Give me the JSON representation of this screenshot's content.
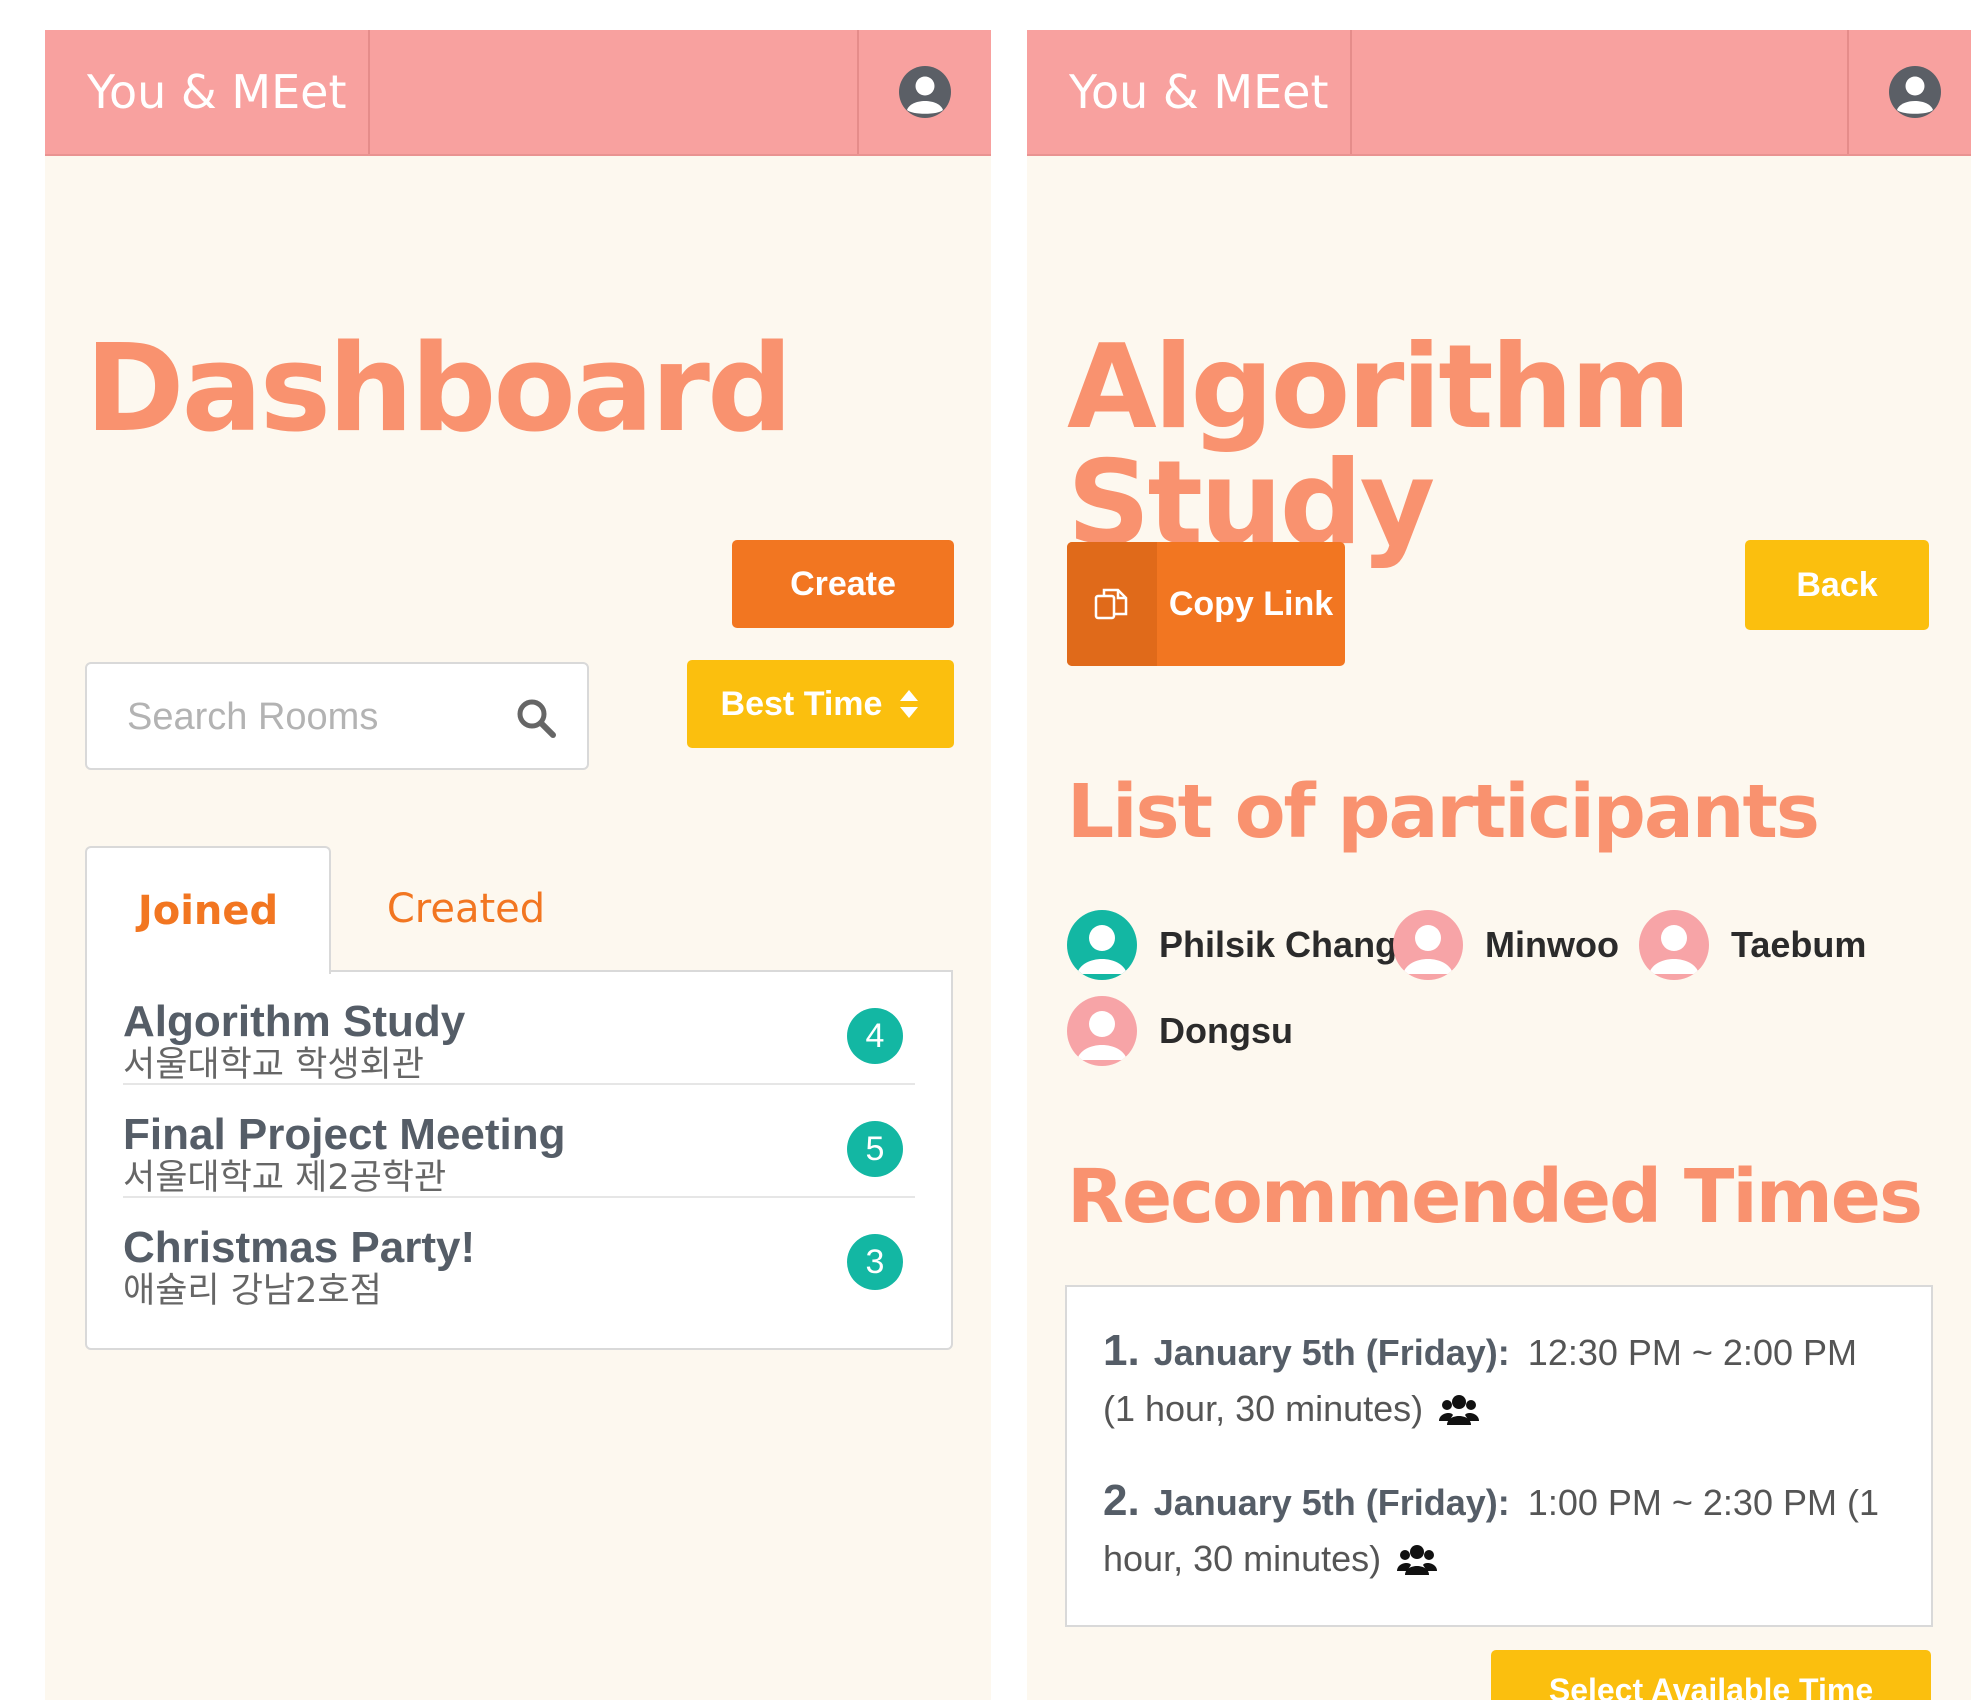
{
  "app": {
    "brand": "You & MEet"
  },
  "dashboard": {
    "title": "Dashboard",
    "create_label": "Create",
    "best_time_label": "Best Time",
    "search": {
      "placeholder": "Search Rooms"
    },
    "tabs": [
      {
        "label": "Joined",
        "active": true
      },
      {
        "label": "Created",
        "active": false
      }
    ],
    "rooms": [
      {
        "name": "Algorithm Study",
        "location": "서울대학교 학생회관",
        "count": "4"
      },
      {
        "name": "Final Project Meeting",
        "location": "서울대학교 제2공학관",
        "count": "5"
      },
      {
        "name": "Christmas Party!",
        "location": "애슐리 강남2호점",
        "count": "3"
      }
    ]
  },
  "room": {
    "title": "Algorithm Study",
    "copy_link_label": "Copy Link",
    "back_label": "Back",
    "participants_heading": "List of participants",
    "participants": [
      {
        "name": "Philsik Chang",
        "color": "#13b7a3"
      },
      {
        "name": "Minwoo",
        "color": "#f7a4a7"
      },
      {
        "name": "Taebum",
        "color": "#f7a4a7"
      },
      {
        "name": "Dongsu",
        "color": "#f7a4a7"
      }
    ],
    "recommended_heading": "Recommended Times",
    "recommended": [
      {
        "num": "1.",
        "day": "January 5th (Friday):",
        "time": "12:30 PM ~ 2:00 PM (1 hour, 30 minutes)"
      },
      {
        "num": "2.",
        "day": "January 5th (Friday):",
        "time": "1:00 PM ~ 2:30 PM (1 hour, 30 minutes)"
      }
    ],
    "select_label": "Select Available Time"
  },
  "icons": {
    "user": "user-circle-icon",
    "search": "search-icon",
    "sort": "sort-icon",
    "copy": "copy-icon",
    "people": "users-icon"
  },
  "colors": {
    "header": "#f8a19f",
    "background": "#fdf8ef",
    "title": "#f9926f",
    "orange": "#f27621",
    "yellow": "#fbbf0e",
    "badge": "#13b7a3"
  }
}
